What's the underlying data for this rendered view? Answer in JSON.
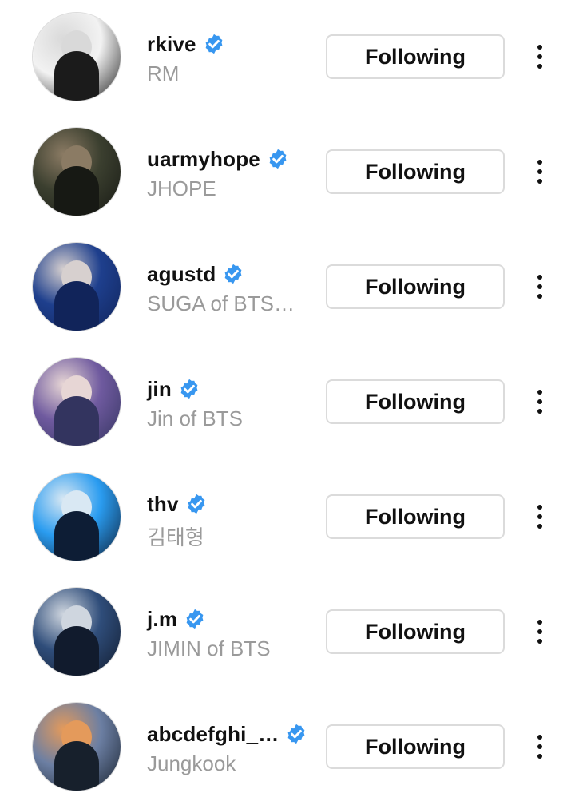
{
  "accounts": [
    {
      "handle": "rkive",
      "subtitle": "RM",
      "verified": true,
      "button_label": "Following",
      "avatar_colors": [
        "#f2f2f2",
        "#1b1b1b",
        "#d9d9d9"
      ]
    },
    {
      "handle": "uarmyhope",
      "subtitle": "JHOPE",
      "verified": true,
      "button_label": "Following",
      "avatar_colors": [
        "#3b3f2f",
        "#171914",
        "#8b7b64"
      ]
    },
    {
      "handle": "agustd",
      "subtitle": "SUGA of BTS…",
      "verified": true,
      "button_label": "Following",
      "avatar_colors": [
        "#1e3f8d",
        "#11245a",
        "#d7d0cf"
      ]
    },
    {
      "handle": "jin",
      "subtitle": "Jin of BTS",
      "verified": true,
      "button_label": "Following",
      "avatar_colors": [
        "#6f5a9f",
        "#33345f",
        "#e7d6d5"
      ]
    },
    {
      "handle": "thv",
      "subtitle": "김태형",
      "verified": true,
      "button_label": "Following",
      "avatar_colors": [
        "#2a9cf0",
        "#0d1d35",
        "#d9e8f3"
      ]
    },
    {
      "handle": "j.m",
      "subtitle": "JIMIN of BTS",
      "verified": true,
      "button_label": "Following",
      "avatar_colors": [
        "#2f4d7a",
        "#111b2d",
        "#cfd6df"
      ]
    },
    {
      "handle": "abcdefghi_…",
      "subtitle": "Jungkook",
      "verified": true,
      "button_label": "Following",
      "avatar_colors": [
        "#6c7fa3",
        "#17202c",
        "#e49a5b"
      ]
    }
  ],
  "colors": {
    "verified_badge": "#3897f0",
    "subtitle_text": "#9a9a9a",
    "button_border": "#dbdbdb"
  },
  "icons": {
    "verified": "verified-badge-icon",
    "more": "more-options-icon"
  }
}
